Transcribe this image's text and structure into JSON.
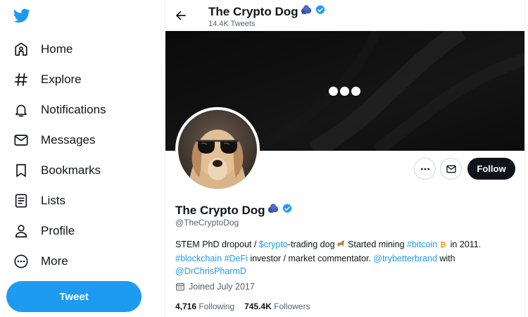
{
  "brand": {
    "accent": "#1d9bf0",
    "text": "#0f1419",
    "muted": "#536471"
  },
  "nav": {
    "items": [
      {
        "label": "Home",
        "icon": "home-icon"
      },
      {
        "label": "Explore",
        "icon": "hashtag-icon"
      },
      {
        "label": "Notifications",
        "icon": "bell-icon"
      },
      {
        "label": "Messages",
        "icon": "envelope-icon"
      },
      {
        "label": "Bookmarks",
        "icon": "bookmark-icon"
      },
      {
        "label": "Lists",
        "icon": "list-icon"
      },
      {
        "label": "Profile",
        "icon": "person-icon"
      },
      {
        "label": "More",
        "icon": "more-circle-icon"
      }
    ],
    "tweet_label": "Tweet"
  },
  "header": {
    "name": "The Crypto Dog",
    "tweet_count": "14.4K Tweets"
  },
  "profile": {
    "name": "The Crypto Dog",
    "handle": "@TheCryptoDog",
    "follow_label": "Follow",
    "bio": {
      "t1": "STEM PhD dropout / ",
      "l1": "$crypto",
      "t2": "-trading dog",
      "t3": " Started mining ",
      "l2": "#bitcoin",
      "t4": " in 2011.",
      "l3": "#blockchain",
      "t5": " ",
      "l4": "#DeFi",
      "t6": " investor / market commentator. ",
      "l5": "@trybetterbrand",
      "t7": " with",
      "l6": "@DrChrisPharmD"
    },
    "joined": "Joined July 2017",
    "following_count": "4,716",
    "following_label": "Following",
    "followers_count": "745.4K",
    "followers_label": "Followers"
  }
}
